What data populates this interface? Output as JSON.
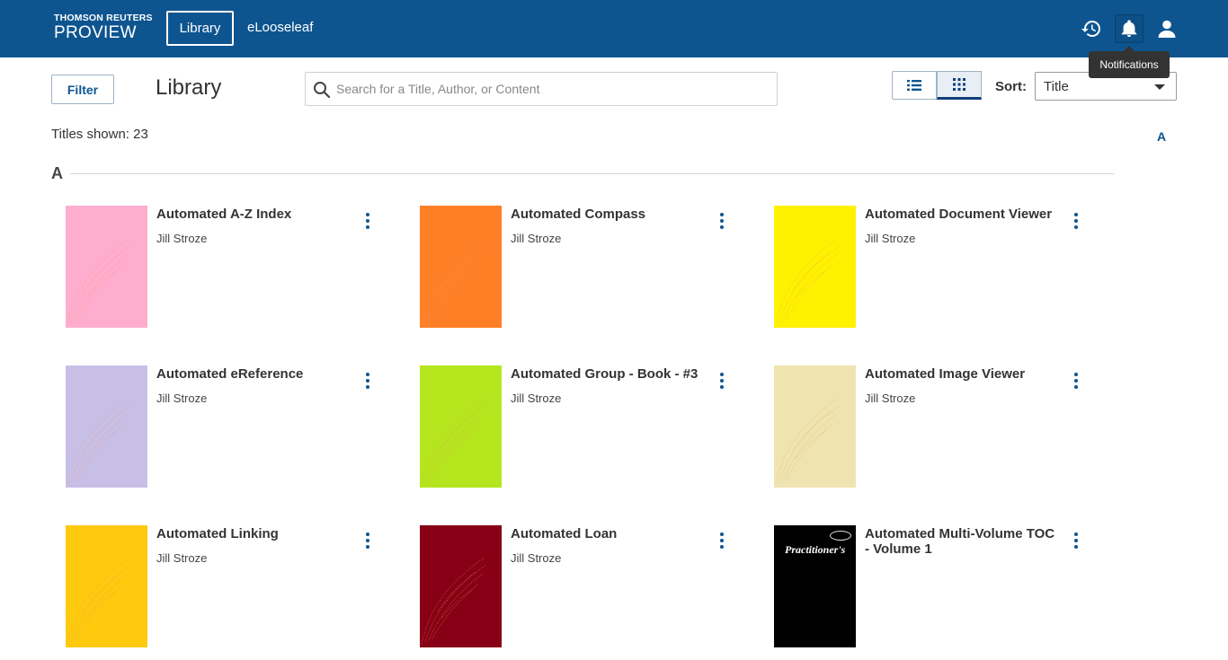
{
  "header": {
    "brand_line1": "THOMSON REUTERS",
    "brand_line2": "PROVIEW",
    "nav": [
      {
        "label": "Library",
        "active": true
      },
      {
        "label": "eLooseleaf",
        "active": false
      }
    ],
    "icons": [
      "history-icon",
      "bell-icon",
      "user-icon"
    ],
    "tooltip": "Notifications",
    "bg_color": "#0e5590"
  },
  "toolbar": {
    "filter_label": "Filter",
    "page_title": "Library",
    "search_placeholder": "Search for a Title, Author, or Content",
    "view_modes": [
      "list",
      "grid"
    ],
    "active_view": "grid",
    "sort_label": "Sort:",
    "sort_value": "Title"
  },
  "titles_shown": "Titles shown: 23",
  "alpha_index": [
    "A"
  ],
  "sections": [
    {
      "letter": "A",
      "books": [
        {
          "title": "Automated A-Z Index",
          "author": "Jill Stroze",
          "cover_color": "#ffadce"
        },
        {
          "title": "Automated Compass",
          "author": "Jill Stroze",
          "cover_color": "#ff7f27"
        },
        {
          "title": "Automated Document Viewer",
          "author": "Jill Stroze",
          "cover_color": "#fff200"
        },
        {
          "title": "Automated eReference",
          "author": "Jill Stroze",
          "cover_color": "#c8bfe7"
        },
        {
          "title": "Automated Group - Book - #3",
          "author": "Jill Stroze",
          "cover_color": "#b5e61d"
        },
        {
          "title": "Automated Image Viewer",
          "author": "Jill Stroze",
          "cover_color": "#efe4b0"
        },
        {
          "title": "Automated Linking",
          "author": "Jill Stroze",
          "cover_color": "#ffc90e"
        },
        {
          "title": "Automated Loan",
          "author": "Jill Stroze",
          "cover_color": "#880015"
        },
        {
          "title": "Automated Multi-Volume TOC - Volume 1",
          "author": "",
          "cover_color": "#000000",
          "cover_text": "Practitioner's"
        }
      ]
    }
  ]
}
